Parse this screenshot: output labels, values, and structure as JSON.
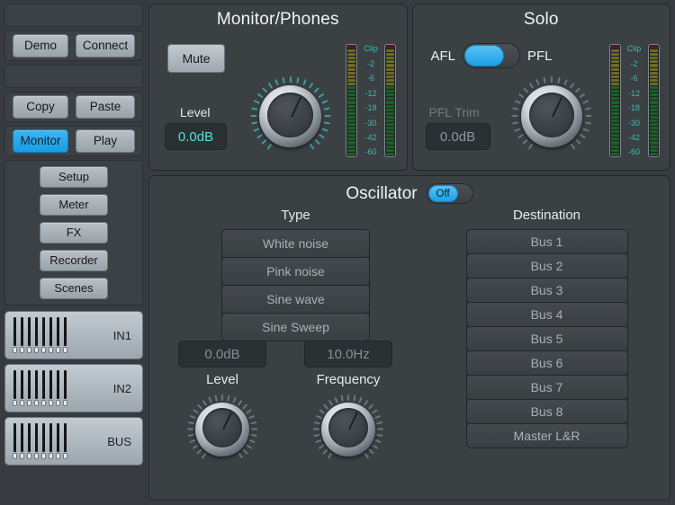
{
  "sidebar": {
    "row1": {
      "buttons": [
        "Demo",
        "Connect"
      ]
    },
    "row2": {
      "buttons": [
        "Copy",
        "Paste"
      ]
    },
    "row3": {
      "buttons": [
        "Monitor",
        "Play"
      ],
      "active": "Monitor"
    },
    "nav": [
      "Setup",
      "Meter",
      "FX",
      "Recorder",
      "Scenes"
    ],
    "strips": [
      {
        "label": "IN1"
      },
      {
        "label": "IN2"
      },
      {
        "label": "BUS"
      }
    ]
  },
  "monitor": {
    "title": "Monitor/Phones",
    "mute_label": "Mute",
    "level_label": "Level",
    "level_value": "0.0dB",
    "meter_scale": [
      "Clip",
      "-2",
      "-6",
      "-12",
      "-18",
      "-30",
      "-42",
      "-60"
    ]
  },
  "solo": {
    "title": "Solo",
    "afl_label": "AFL",
    "pfl_label": "PFL",
    "toggle_state": "AFL",
    "trim_label": "PFL Trim",
    "trim_value": "0.0dB",
    "meter_scale": [
      "Clip",
      "-2",
      "-6",
      "-12",
      "-18",
      "-30",
      "-42",
      "-60"
    ]
  },
  "oscillator": {
    "title": "Oscillator",
    "power_state": "Off",
    "type_title": "Type",
    "types": [
      "White noise",
      "Pink noise",
      "Sine wave",
      "Sine Sweep"
    ],
    "destination_title": "Destination",
    "destinations": [
      "Bus 1",
      "Bus 2",
      "Bus 3",
      "Bus 4",
      "Bus 5",
      "Bus 6",
      "Bus 7",
      "Bus 8",
      "Master L&R"
    ],
    "level_value": "0.0dB",
    "level_label": "Level",
    "frequency_value": "10.0Hz",
    "frequency_label": "Frequency"
  },
  "colors": {
    "accent_blue": "#1ba0e8",
    "accent_teal": "#56e0d6",
    "panel_bg": "#3b4043",
    "app_bg": "#383c40"
  }
}
